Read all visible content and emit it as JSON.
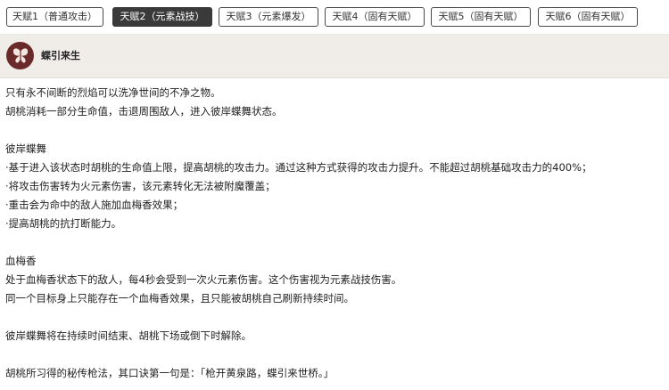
{
  "tabs": [
    {
      "label": "天赋1（普通攻击）",
      "active": false
    },
    {
      "label": "天赋2（元素战技）",
      "active": true
    },
    {
      "label": "天赋3（元素爆发）",
      "active": false
    },
    {
      "label": "天赋4（固有天赋）",
      "active": false
    },
    {
      "label": "天赋5（固有天赋）",
      "active": false
    },
    {
      "label": "天赋6（固有天赋）",
      "active": false
    }
  ],
  "skill": {
    "name": "蝶引来生",
    "icon": "butterfly-icon"
  },
  "description": {
    "l1": "只有永不间断的烈焰可以洗净世间的不净之物。",
    "l2": "胡桃消耗一部分生命值，击退周围敌人，进入彼岸蝶舞状态。",
    "s1_title": "彼岸蝶舞",
    "s1_b1": "·基于进入该状态时胡桃的生命值上限，提高胡桃的攻击力。通过这种方式获得的攻击力提升。不能超过胡桃基础攻击力的400%；",
    "s1_b2": "·将攻击伤害转为火元素伤害，该元素转化无法被附魔覆盖；",
    "s1_b3": "·重击会为命中的敌人施加血梅香效果；",
    "s1_b4": "·提高胡桃的抗打断能力。",
    "s2_title": "血梅香",
    "s2_l1": "处于血梅香状态下的敌人，每4秒会受到一次火元素伤害。这个伤害视为元素战技伤害。",
    "s2_l2": "同一个目标身上只能存在一个血梅香效果，且只能被胡桃自己刷新持续时间。",
    "l3": "彼岸蝶舞将在持续时间结束、胡桃下场或倒下时解除。",
    "l4": "胡桃所习得的秘传枪法，其口诀第一句是：「枪开黄泉路，蝶引来世桥。」"
  }
}
